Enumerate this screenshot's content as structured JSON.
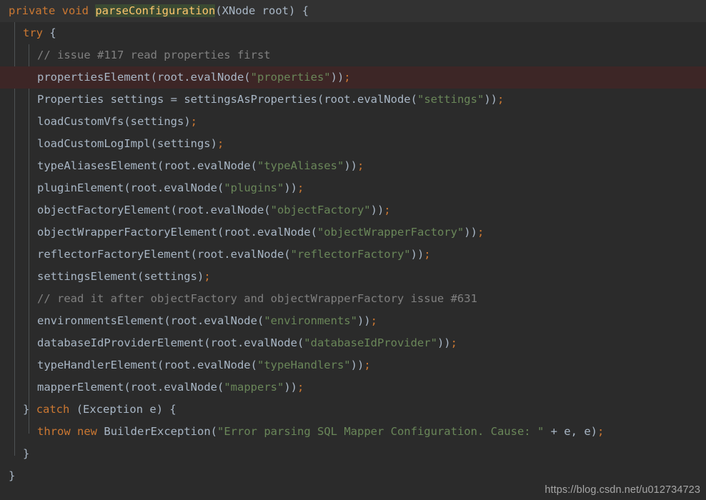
{
  "editor": {
    "language": "java",
    "background": "#2b2b2b",
    "caret_line_background": "#323232",
    "error_line_background": "#3d2626",
    "default_text_color": "#a9b7c6",
    "keyword_color": "#cc7832",
    "string_color": "#6a8759",
    "comment_color": "#808080",
    "highlight_token_bg": "#3a4a33",
    "highlight_token_color": "#ffc66d",
    "indent_guide_color": "#4e5254",
    "line_height_px": 31,
    "font_size_px": 15.5
  },
  "watermark": {
    "text": "https://blog.csdn.net/u012734723"
  },
  "code": {
    "lines": [
      {
        "index": 1,
        "state": "caret",
        "indent": 0,
        "text": "private void parseConfiguration(XNode root) {",
        "tokens": [
          {
            "t": "private",
            "c": "kw"
          },
          {
            "t": " ",
            "c": "pun"
          },
          {
            "t": "void",
            "c": "kw"
          },
          {
            "t": " ",
            "c": "pun"
          },
          {
            "t": "parseConfiguration",
            "c": "mhl"
          },
          {
            "t": "(",
            "c": "pun"
          },
          {
            "t": "XNode",
            "c": "cls"
          },
          {
            "t": " root",
            "c": "id"
          },
          {
            "t": ")",
            "c": "pun"
          },
          {
            "t": " ",
            "c": "pun"
          },
          {
            "t": "{",
            "c": "brc"
          }
        ]
      },
      {
        "index": 2,
        "state": "normal",
        "indent": 1,
        "text": "try {",
        "tokens": [
          {
            "t": "try",
            "c": "kw"
          },
          {
            "t": " ",
            "c": "pun"
          },
          {
            "t": "{",
            "c": "brc"
          }
        ]
      },
      {
        "index": 3,
        "state": "normal",
        "indent": 2,
        "text": "// issue #117 read properties first",
        "tokens": [
          {
            "t": "// issue #117 read properties first",
            "c": "cmt"
          }
        ]
      },
      {
        "index": 4,
        "state": "error",
        "indent": 2,
        "text": "propertiesElement(root.evalNode(\"properties\"));",
        "tokens": [
          {
            "t": "propertiesElement",
            "c": "fn"
          },
          {
            "t": "(root.",
            "c": "pun"
          },
          {
            "t": "evalNode",
            "c": "fn"
          },
          {
            "t": "(",
            "c": "pun"
          },
          {
            "t": "\"properties\"",
            "c": "str"
          },
          {
            "t": "))",
            "c": "pun"
          },
          {
            "t": ";",
            "c": "semi"
          }
        ]
      },
      {
        "index": 5,
        "state": "normal",
        "indent": 2,
        "text": "Properties settings = settingsAsProperties(root.evalNode(\"settings\"));",
        "tokens": [
          {
            "t": "Properties",
            "c": "cls"
          },
          {
            "t": " settings ",
            "c": "id"
          },
          {
            "t": "=",
            "c": "pun"
          },
          {
            "t": " ",
            "c": "pun"
          },
          {
            "t": "settingsAsProperties",
            "c": "fn"
          },
          {
            "t": "(root.",
            "c": "pun"
          },
          {
            "t": "evalNode",
            "c": "fn"
          },
          {
            "t": "(",
            "c": "pun"
          },
          {
            "t": "\"settings\"",
            "c": "str"
          },
          {
            "t": "))",
            "c": "pun"
          },
          {
            "t": ";",
            "c": "semi"
          }
        ]
      },
      {
        "index": 6,
        "state": "normal",
        "indent": 2,
        "text": "loadCustomVfs(settings);",
        "tokens": [
          {
            "t": "loadCustomVfs",
            "c": "fn"
          },
          {
            "t": "(settings)",
            "c": "pun"
          },
          {
            "t": ";",
            "c": "semi"
          }
        ]
      },
      {
        "index": 7,
        "state": "normal",
        "indent": 2,
        "text": "loadCustomLogImpl(settings);",
        "tokens": [
          {
            "t": "loadCustomLogImpl",
            "c": "fn"
          },
          {
            "t": "(settings)",
            "c": "pun"
          },
          {
            "t": ";",
            "c": "semi"
          }
        ]
      },
      {
        "index": 8,
        "state": "normal",
        "indent": 2,
        "text": "typeAliasesElement(root.evalNode(\"typeAliases\"));",
        "tokens": [
          {
            "t": "typeAliasesElement",
            "c": "fn"
          },
          {
            "t": "(root.",
            "c": "pun"
          },
          {
            "t": "evalNode",
            "c": "fn"
          },
          {
            "t": "(",
            "c": "pun"
          },
          {
            "t": "\"typeAliases\"",
            "c": "str"
          },
          {
            "t": "))",
            "c": "pun"
          },
          {
            "t": ";",
            "c": "semi"
          }
        ]
      },
      {
        "index": 9,
        "state": "normal",
        "indent": 2,
        "text": "pluginElement(root.evalNode(\"plugins\"));",
        "tokens": [
          {
            "t": "pluginElement",
            "c": "fn"
          },
          {
            "t": "(root.",
            "c": "pun"
          },
          {
            "t": "evalNode",
            "c": "fn"
          },
          {
            "t": "(",
            "c": "pun"
          },
          {
            "t": "\"plugins\"",
            "c": "str"
          },
          {
            "t": "))",
            "c": "pun"
          },
          {
            "t": ";",
            "c": "semi"
          }
        ]
      },
      {
        "index": 10,
        "state": "normal",
        "indent": 2,
        "text": "objectFactoryElement(root.evalNode(\"objectFactory\"));",
        "tokens": [
          {
            "t": "objectFactoryElement",
            "c": "fn"
          },
          {
            "t": "(root.",
            "c": "pun"
          },
          {
            "t": "evalNode",
            "c": "fn"
          },
          {
            "t": "(",
            "c": "pun"
          },
          {
            "t": "\"objectFactory\"",
            "c": "str"
          },
          {
            "t": "))",
            "c": "pun"
          },
          {
            "t": ";",
            "c": "semi"
          }
        ]
      },
      {
        "index": 11,
        "state": "normal",
        "indent": 2,
        "text": "objectWrapperFactoryElement(root.evalNode(\"objectWrapperFactory\"));",
        "tokens": [
          {
            "t": "objectWrapperFactoryElement",
            "c": "fn"
          },
          {
            "t": "(root.",
            "c": "pun"
          },
          {
            "t": "evalNode",
            "c": "fn"
          },
          {
            "t": "(",
            "c": "pun"
          },
          {
            "t": "\"objectWrapperFactory\"",
            "c": "str"
          },
          {
            "t": "))",
            "c": "pun"
          },
          {
            "t": ";",
            "c": "semi"
          }
        ]
      },
      {
        "index": 12,
        "state": "normal",
        "indent": 2,
        "text": "reflectorFactoryElement(root.evalNode(\"reflectorFactory\"));",
        "tokens": [
          {
            "t": "reflectorFactoryElement",
            "c": "fn"
          },
          {
            "t": "(root.",
            "c": "pun"
          },
          {
            "t": "evalNode",
            "c": "fn"
          },
          {
            "t": "(",
            "c": "pun"
          },
          {
            "t": "\"reflectorFactory\"",
            "c": "str"
          },
          {
            "t": "))",
            "c": "pun"
          },
          {
            "t": ";",
            "c": "semi"
          }
        ]
      },
      {
        "index": 13,
        "state": "normal",
        "indent": 2,
        "text": "settingsElement(settings);",
        "tokens": [
          {
            "t": "settingsElement",
            "c": "fn"
          },
          {
            "t": "(settings)",
            "c": "pun"
          },
          {
            "t": ";",
            "c": "semi"
          }
        ]
      },
      {
        "index": 14,
        "state": "normal",
        "indent": 2,
        "text": "// read it after objectFactory and objectWrapperFactory issue #631",
        "tokens": [
          {
            "t": "// read it after objectFactory and objectWrapperFactory issue #631",
            "c": "cmt"
          }
        ]
      },
      {
        "index": 15,
        "state": "normal",
        "indent": 2,
        "text": "environmentsElement(root.evalNode(\"environments\"));",
        "tokens": [
          {
            "t": "environmentsElement",
            "c": "fn"
          },
          {
            "t": "(root.",
            "c": "pun"
          },
          {
            "t": "evalNode",
            "c": "fn"
          },
          {
            "t": "(",
            "c": "pun"
          },
          {
            "t": "\"environments\"",
            "c": "str"
          },
          {
            "t": "))",
            "c": "pun"
          },
          {
            "t": ";",
            "c": "semi"
          }
        ]
      },
      {
        "index": 16,
        "state": "normal",
        "indent": 2,
        "text": "databaseIdProviderElement(root.evalNode(\"databaseIdProvider\"));",
        "tokens": [
          {
            "t": "databaseIdProviderElement",
            "c": "fn"
          },
          {
            "t": "(root.",
            "c": "pun"
          },
          {
            "t": "evalNode",
            "c": "fn"
          },
          {
            "t": "(",
            "c": "pun"
          },
          {
            "t": "\"databaseIdProvider\"",
            "c": "str"
          },
          {
            "t": "))",
            "c": "pun"
          },
          {
            "t": ";",
            "c": "semi"
          }
        ]
      },
      {
        "index": 17,
        "state": "normal",
        "indent": 2,
        "text": "typeHandlerElement(root.evalNode(\"typeHandlers\"));",
        "tokens": [
          {
            "t": "typeHandlerElement",
            "c": "fn"
          },
          {
            "t": "(root.",
            "c": "pun"
          },
          {
            "t": "evalNode",
            "c": "fn"
          },
          {
            "t": "(",
            "c": "pun"
          },
          {
            "t": "\"typeHandlers\"",
            "c": "str"
          },
          {
            "t": "))",
            "c": "pun"
          },
          {
            "t": ";",
            "c": "semi"
          }
        ]
      },
      {
        "index": 18,
        "state": "normal",
        "indent": 2,
        "text": "mapperElement(root.evalNode(\"mappers\"));",
        "tokens": [
          {
            "t": "mapperElement",
            "c": "fn"
          },
          {
            "t": "(root.",
            "c": "pun"
          },
          {
            "t": "evalNode",
            "c": "fn"
          },
          {
            "t": "(",
            "c": "pun"
          },
          {
            "t": "\"mappers\"",
            "c": "str"
          },
          {
            "t": "))",
            "c": "pun"
          },
          {
            "t": ";",
            "c": "semi"
          }
        ]
      },
      {
        "index": 19,
        "state": "normal",
        "indent": 1,
        "text": "} catch (Exception e) {",
        "tokens": [
          {
            "t": "}",
            "c": "brc"
          },
          {
            "t": " ",
            "c": "pun"
          },
          {
            "t": "catch",
            "c": "kw"
          },
          {
            "t": " ",
            "c": "pun"
          },
          {
            "t": "(",
            "c": "pun"
          },
          {
            "t": "Exception",
            "c": "cls"
          },
          {
            "t": " e",
            "c": "id"
          },
          {
            "t": ")",
            "c": "pun"
          },
          {
            "t": " ",
            "c": "pun"
          },
          {
            "t": "{",
            "c": "brc"
          }
        ]
      },
      {
        "index": 20,
        "state": "normal",
        "indent": 2,
        "text": "throw new BuilderException(\"Error parsing SQL Mapper Configuration. Cause: \" + e, e);",
        "tokens": [
          {
            "t": "throw",
            "c": "kw"
          },
          {
            "t": " ",
            "c": "pun"
          },
          {
            "t": "new",
            "c": "kw"
          },
          {
            "t": " ",
            "c": "pun"
          },
          {
            "t": "BuilderException",
            "c": "cls"
          },
          {
            "t": "(",
            "c": "pun"
          },
          {
            "t": "\"Error parsing SQL Mapper Configuration. Cause: \"",
            "c": "str"
          },
          {
            "t": " ",
            "c": "pun"
          },
          {
            "t": "+",
            "c": "pun"
          },
          {
            "t": " e",
            "c": "id"
          },
          {
            "t": ",",
            "c": "pun"
          },
          {
            "t": " e",
            "c": "id"
          },
          {
            "t": ")",
            "c": "pun"
          },
          {
            "t": ";",
            "c": "semi"
          }
        ]
      },
      {
        "index": 21,
        "state": "normal",
        "indent": 1,
        "text": "}",
        "tokens": [
          {
            "t": "}",
            "c": "brc"
          }
        ]
      },
      {
        "index": 22,
        "state": "normal",
        "indent": 0,
        "text": "}",
        "tokens": [
          {
            "t": "}",
            "c": "brc"
          }
        ]
      }
    ]
  }
}
